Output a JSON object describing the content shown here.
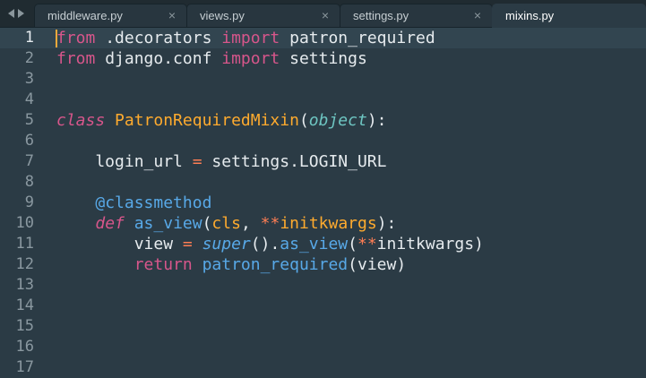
{
  "tabs": [
    {
      "label": "middleware.py",
      "active": false
    },
    {
      "label": "views.py",
      "active": false
    },
    {
      "label": "settings.py",
      "active": false
    },
    {
      "label": "mixins.py",
      "active": true
    }
  ],
  "close_glyph": "×",
  "editor": {
    "current_line": 1,
    "lines": [
      {
        "n": "1",
        "tokens": [
          {
            "t": "from",
            "c": "kw"
          },
          {
            "t": " .decorators ",
            "c": ""
          },
          {
            "t": "import",
            "c": "kw"
          },
          {
            "t": " patron_required",
            "c": ""
          }
        ]
      },
      {
        "n": "2",
        "tokens": [
          {
            "t": "from",
            "c": "kw"
          },
          {
            "t": " django.conf ",
            "c": ""
          },
          {
            "t": "import",
            "c": "kw"
          },
          {
            "t": " settings",
            "c": ""
          }
        ]
      },
      {
        "n": "3",
        "tokens": []
      },
      {
        "n": "4",
        "tokens": []
      },
      {
        "n": "5",
        "tokens": [
          {
            "t": "class",
            "c": "stor"
          },
          {
            "t": " ",
            "c": ""
          },
          {
            "t": "PatronRequiredMixin",
            "c": "cls"
          },
          {
            "t": "(",
            "c": ""
          },
          {
            "t": "object",
            "c": "tp"
          },
          {
            "t": "):",
            "c": ""
          }
        ]
      },
      {
        "n": "6",
        "tokens": []
      },
      {
        "n": "7",
        "tokens": [
          {
            "t": "    login_url ",
            "c": ""
          },
          {
            "t": "=",
            "c": "op"
          },
          {
            "t": " settings.LOGIN_URL",
            "c": ""
          }
        ]
      },
      {
        "n": "8",
        "tokens": []
      },
      {
        "n": "9",
        "tokens": [
          {
            "t": "    ",
            "c": ""
          },
          {
            "t": "@classmethod",
            "c": "dec"
          }
        ]
      },
      {
        "n": "10",
        "tokens": [
          {
            "t": "    ",
            "c": ""
          },
          {
            "t": "def",
            "c": "stor"
          },
          {
            "t": " ",
            "c": ""
          },
          {
            "t": "as_view",
            "c": "fn"
          },
          {
            "t": "(",
            "c": ""
          },
          {
            "t": "cls",
            "c": "arg"
          },
          {
            "t": ", ",
            "c": ""
          },
          {
            "t": "**",
            "c": "op"
          },
          {
            "t": "initkwargs",
            "c": "arg"
          },
          {
            "t": "):",
            "c": ""
          }
        ]
      },
      {
        "n": "11",
        "tokens": [
          {
            "t": "        view ",
            "c": ""
          },
          {
            "t": "=",
            "c": "op"
          },
          {
            "t": " ",
            "c": ""
          },
          {
            "t": "super",
            "c": "bi"
          },
          {
            "t": "().",
            "c": ""
          },
          {
            "t": "as_view",
            "c": "fn"
          },
          {
            "t": "(",
            "c": ""
          },
          {
            "t": "**",
            "c": "op"
          },
          {
            "t": "initkwargs)",
            "c": ""
          }
        ]
      },
      {
        "n": "12",
        "tokens": [
          {
            "t": "        ",
            "c": ""
          },
          {
            "t": "return",
            "c": "kw"
          },
          {
            "t": " ",
            "c": ""
          },
          {
            "t": "patron_required",
            "c": "fn"
          },
          {
            "t": "(view)",
            "c": ""
          }
        ]
      },
      {
        "n": "13",
        "tokens": []
      },
      {
        "n": "14",
        "tokens": []
      },
      {
        "n": "15",
        "tokens": []
      },
      {
        "n": "16",
        "tokens": []
      },
      {
        "n": "17",
        "tokens": []
      }
    ]
  },
  "theme": {
    "background": "#2b3b45",
    "tabbar": "#202b31",
    "caret": "#f2a93b"
  }
}
